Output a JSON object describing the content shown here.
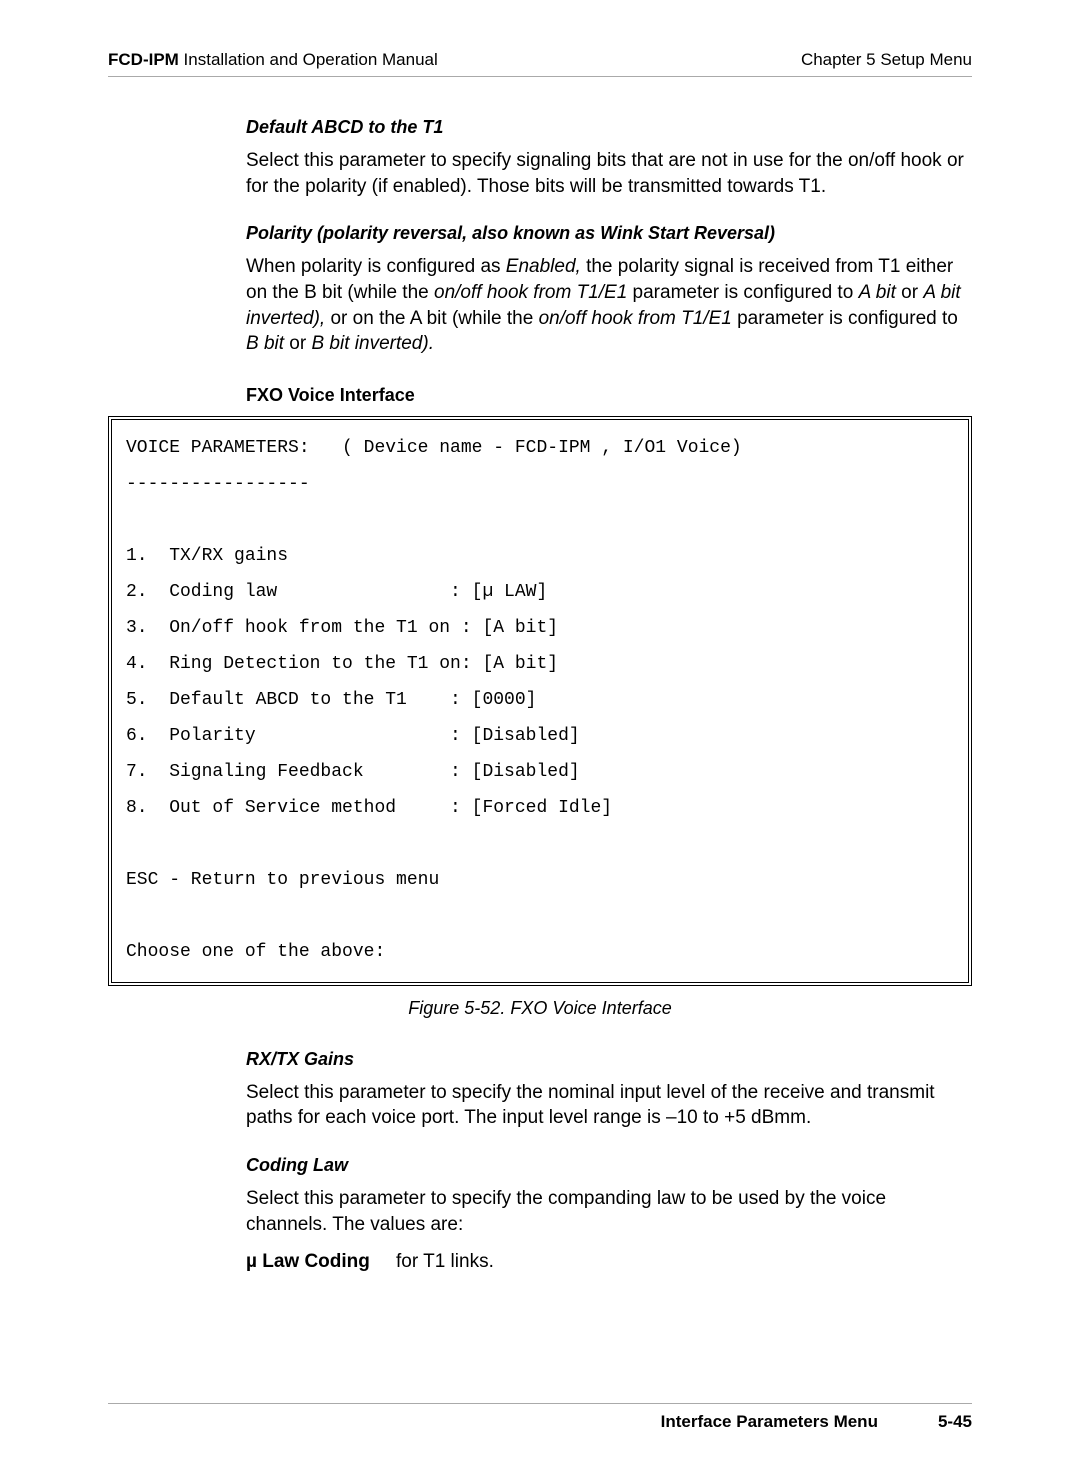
{
  "header": {
    "left_bold": "FCD-IPM",
    "left_rest": " Installation and Operation Manual",
    "right": "Chapter 5  Setup Menu"
  },
  "sec1": {
    "heading": "Default ABCD to the T1",
    "para": "Select this parameter to specify signaling bits that are not in use for the on/off hook or for the polarity (if enabled). Those bits will be transmitted towards T1."
  },
  "sec2": {
    "heading": "Polarity (polarity reversal, also known as Wink Start Reversal)",
    "p1a": "When polarity is configured as ",
    "p1b": "Enabled,",
    "p1c": " the polarity signal is received from T1 either on the B bit (while the ",
    "p1d": "on/off hook from T1/E1",
    "p1e": " parameter is configured to ",
    "p1f": "A bit",
    "p1g": " or ",
    "p1h": "A bit inverted),",
    "p1i": " or on the A bit (while the ",
    "p1j": "on/off hook from T1/E1",
    "p1k": " parameter is configured to ",
    "p1l": "B bit",
    "p1m": " or ",
    "p1n": "B bit inverted)."
  },
  "sec3": {
    "heading": "FXO Voice Interface"
  },
  "code": {
    "line1": "VOICE PARAMETERS:   ( Device name - FCD-IPM , I/O1 Voice)",
    "line2": "-----------------",
    "blank": " ",
    "line3": "1.  TX/RX gains",
    "line4": "2.  Coding law                : [µ LAW]",
    "line5": "3.  On/off hook from the T1 on : [A bit]",
    "line6": "4.  Ring Detection to the T1 on: [A bit]",
    "line7": "5.  Default ABCD to the T1    : [0000]",
    "line8": "6.  Polarity                  : [Disabled]",
    "line9": "7.  Signaling Feedback        : [Disabled]",
    "line10": "8.  Out of Service method     : [Forced Idle]",
    "line11": "ESC - Return to previous menu",
    "line12": "Choose one of the above:"
  },
  "figure_caption": "Figure 5-52.  FXO Voice Interface",
  "sec4": {
    "heading": "RX/TX Gains",
    "para": "Select this parameter to specify the nominal input level of the receive and transmit paths for each voice port. The input level range is –10 to +5 dBmm."
  },
  "sec5": {
    "heading": "Coding Law",
    "para": "Select this parameter to specify the companding law to be used by the voice channels. The values are:",
    "def_term": "µ Law Coding",
    "def_desc": "for T1 links."
  },
  "footer": {
    "section": "Interface Parameters Menu",
    "page": "5-45"
  }
}
